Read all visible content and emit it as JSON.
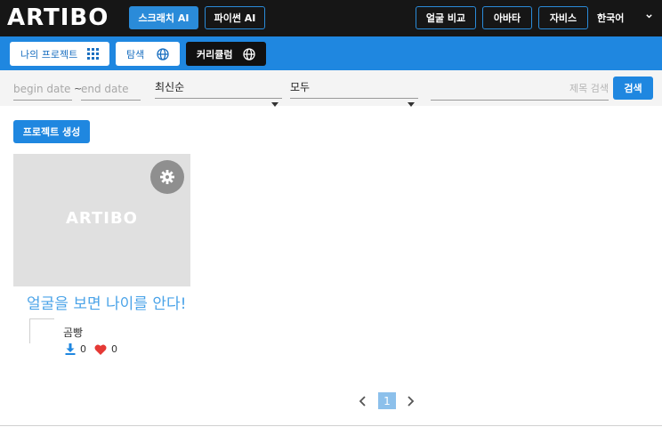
{
  "header": {
    "logo": "ARTIBO",
    "buttons": {
      "scratch_ai": "스크래치 AI",
      "python_ai": "파이썬 AI",
      "face_compare": "얼굴 비교",
      "avatar": "아바타",
      "jarvis": "자비스"
    },
    "language": "한국어"
  },
  "nav": {
    "my_projects": "나의 프로젝트",
    "explore": "탐색",
    "curriculum": "커리큘럼"
  },
  "filters": {
    "begin_date_placeholder": "begin date",
    "date_separator": "~",
    "end_date_placeholder": "end date",
    "sort_selected": "최신순",
    "category_selected": "모두",
    "search_placeholder": "제목 검색",
    "search_button": "검색"
  },
  "create_button": "프로젝트 생성",
  "projects": [
    {
      "thumbnail_logo": "ARTIBO",
      "title": "얼굴을 보면 나이를 안다!",
      "author": "곰빵",
      "downloads": "0",
      "likes": "0"
    }
  ],
  "pagination": {
    "current_page": "1"
  },
  "colors": {
    "header_bg": "#161616",
    "accent": "#1f87e0",
    "card_title": "#4aa3e8",
    "like": "#e53935",
    "download": "#1f87e0"
  },
  "icons": {
    "my_projects": "grid-icon",
    "explore": "globe-icon",
    "curriculum": "globe-icon",
    "card_settings": "gear-icon",
    "downloads": "download-icon",
    "likes": "heart-icon"
  }
}
